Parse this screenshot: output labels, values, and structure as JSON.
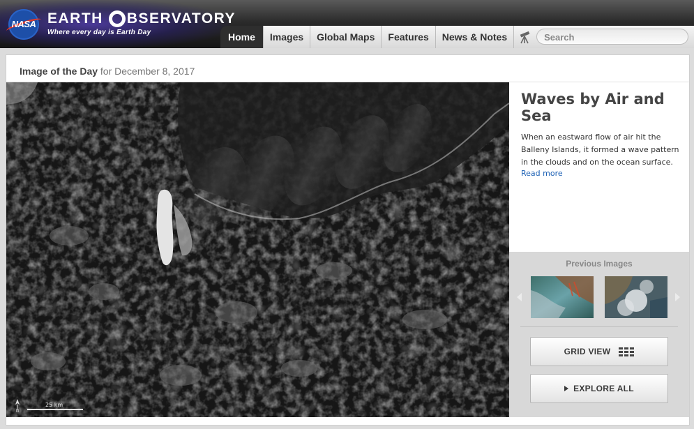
{
  "brand": {
    "agency_logo_text": "NASA",
    "title_part1": "EARTH",
    "title_part2": "BSERVATORY",
    "tagline": "Where every day is Earth Day"
  },
  "nav": {
    "items": [
      {
        "label": "Home",
        "active": true
      },
      {
        "label": "Images",
        "active": false
      },
      {
        "label": "Global Maps",
        "active": false
      },
      {
        "label": "Features",
        "active": false
      },
      {
        "label": "News & Notes",
        "active": false
      }
    ],
    "search_placeholder": "Search"
  },
  "iotd": {
    "heading": "Image of the Day",
    "date_text": "for December 8, 2017"
  },
  "image": {
    "scale_label": "25 km",
    "north_label": "N"
  },
  "story": {
    "title": "Waves by Air and Sea",
    "description": "When an eastward flow of air hit the Balleny Islands, it formed a wave pattern in the clouds and on the ocean surface.",
    "read_more": "Read more"
  },
  "gallery": {
    "previous_label": "Previous Images",
    "grid_view_label": "GRID VIEW",
    "explore_all_label": "EXPLORE ALL"
  },
  "colors": {
    "link": "#1a5fb4",
    "header_dark": "#141414",
    "active_tab": "#2e2e2e",
    "gallery_bg": "#d8d8d8"
  }
}
